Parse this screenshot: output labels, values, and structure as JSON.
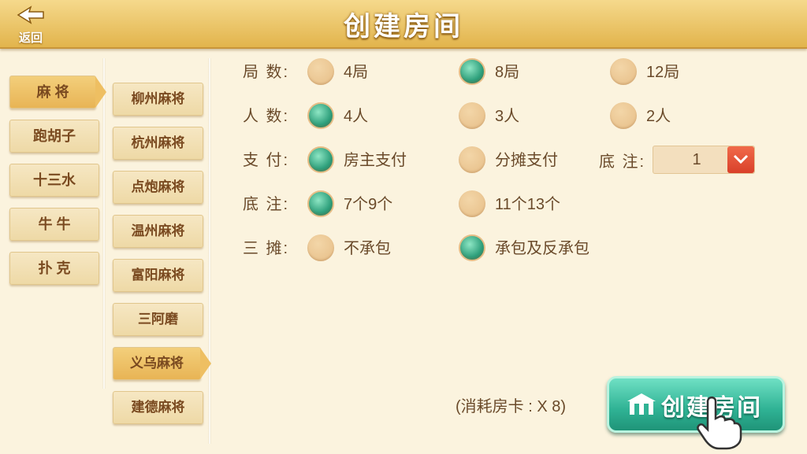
{
  "header": {
    "title": "创建房间",
    "back_label": "返回"
  },
  "categories": [
    "麻 将",
    "跑胡子",
    "十三水",
    "牛 牛",
    "扑 克"
  ],
  "active_category": 0,
  "games": [
    "柳州麻将",
    "杭州麻将",
    "点炮麻将",
    "温州麻将",
    "富阳麻将",
    "三阿磨",
    "义乌麻将",
    "建德麻将"
  ],
  "active_game": 6,
  "options": [
    {
      "label": "局 数:",
      "choices": [
        "4局",
        "8局",
        "12局"
      ],
      "selected": 1
    },
    {
      "label": "人 数:",
      "choices": [
        "4人",
        "3人",
        "2人"
      ],
      "selected": 0
    },
    {
      "label": "支 付:",
      "choices": [
        "房主支付",
        "分摊支付"
      ],
      "selected": 0
    },
    {
      "label": "底 注:",
      "choices": [
        "7个9个",
        "11个13个"
      ],
      "selected": 0
    },
    {
      "label": "三 摊:",
      "choices": [
        "不承包",
        "承包及反承包"
      ],
      "selected": 1
    }
  ],
  "base_bet": {
    "label": "底 注:",
    "value": "1"
  },
  "cost_text": "(消耗房卡 : X 8)",
  "create_button": "创建房间",
  "colors": {
    "header": "#e2b44c",
    "selected_radio": "#2fa07c",
    "create_button": "#2fb294"
  }
}
